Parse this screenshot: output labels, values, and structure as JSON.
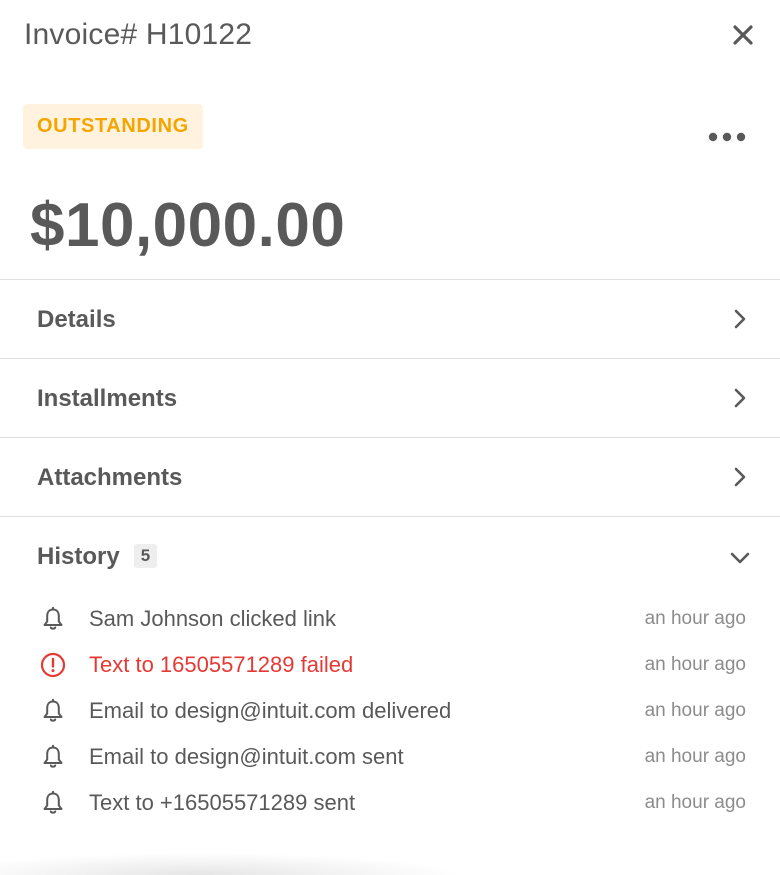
{
  "header": {
    "title": "Invoice# H10122",
    "close_icon": "close-icon"
  },
  "status": {
    "label": "OUTSTANDING",
    "color": "#f5a500",
    "background": "#fff3e0"
  },
  "more_icon": "more-horizontal-icon",
  "amount": "$10,000.00",
  "sections": {
    "details": "Details",
    "installments": "Installments",
    "attachments": "Attachments",
    "history": {
      "label": "History",
      "count": "5"
    }
  },
  "history": [
    {
      "icon": "bell-icon",
      "text": "Sam Johnson clicked link",
      "time": "an hour ago",
      "status": "normal"
    },
    {
      "icon": "alert-circle-icon",
      "text": "Text to 16505571289 failed",
      "time": "an hour ago",
      "status": "error"
    },
    {
      "icon": "bell-icon",
      "text": "Email to design@intuit.com delivered",
      "time": "an hour ago",
      "status": "normal"
    },
    {
      "icon": "bell-icon",
      "text": "Email to design@intuit.com sent",
      "time": "an hour ago",
      "status": "normal"
    },
    {
      "icon": "bell-icon",
      "text": "Text to +16505571289 sent",
      "time": "an hour ago",
      "status": "normal"
    }
  ],
  "colors": {
    "text": "#595959",
    "muted": "#8c8c8c",
    "error": "#e53935",
    "divider": "#e0e0e0"
  }
}
